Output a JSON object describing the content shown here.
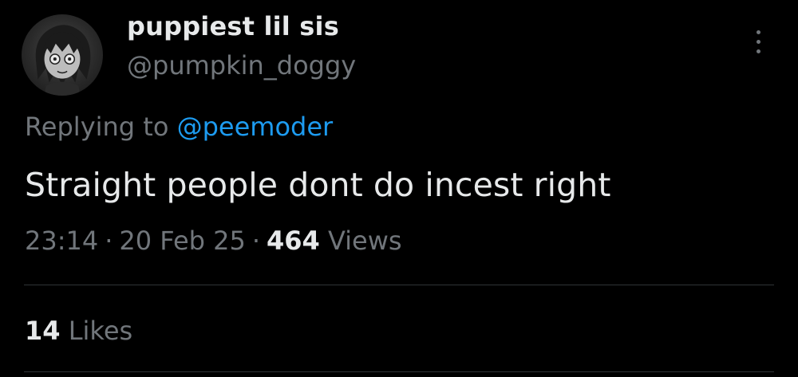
{
  "author": {
    "display_name": "puppiest lil sis",
    "handle": "@pumpkin_doggy",
    "avatar_icon": "avatar-anime-girl"
  },
  "more_icon": "more-vertical-icon",
  "reply": {
    "prefix": "Replying to",
    "mention": "@peemoder"
  },
  "tweet": {
    "text": "Straight people dont do incest right"
  },
  "meta": {
    "time": "23:14",
    "separator": "·",
    "date": "20 Feb 25",
    "views_count": "464",
    "views_label": "Views"
  },
  "engagement": {
    "likes_count": "14",
    "likes_label": "Likes"
  },
  "colors": {
    "background": "#000000",
    "text": "#e7e9ea",
    "muted": "#71767b",
    "link": "#1d9bf0",
    "divider": "#2f3336"
  }
}
